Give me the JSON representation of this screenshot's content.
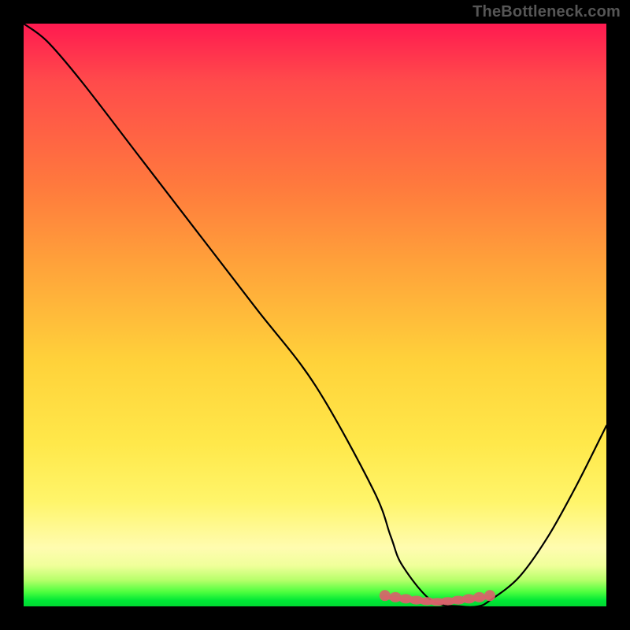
{
  "attribution": "TheBottleneck.com",
  "chart_data": {
    "type": "line",
    "title": "",
    "xlabel": "",
    "ylabel": "",
    "xlim": [
      0,
      100
    ],
    "ylim": [
      0,
      100
    ],
    "series": [
      {
        "name": "curve",
        "x": [
          0,
          4,
          10,
          20,
          30,
          40,
          50,
          60,
          63,
          65,
          70,
          75,
          78,
          80,
          85,
          90,
          95,
          100
        ],
        "values": [
          100,
          97,
          90,
          77,
          64,
          51,
          38,
          20,
          12,
          7,
          1,
          0,
          0,
          1,
          5,
          12,
          21,
          31
        ]
      }
    ],
    "marker_region": {
      "name": "optimal-range",
      "color": "#d9626b",
      "x_start": 62,
      "x_end": 80,
      "y_level": 0.5
    },
    "gradient_colors": {
      "top": "#ff1a50",
      "mid_upper": "#ff9a3a",
      "mid": "#ffe84a",
      "mid_lower": "#fffcb0",
      "bottom": "#00d832"
    }
  }
}
